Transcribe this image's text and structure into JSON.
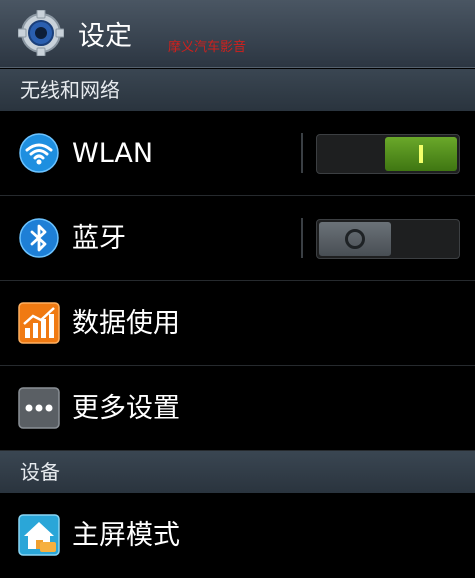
{
  "header": {
    "title": "设定",
    "watermark": "摩义汽车影音"
  },
  "sections": {
    "wireless": "无线和网络",
    "device": "设备"
  },
  "items": {
    "wlan": {
      "label": "WLAN",
      "icon": "wifi-icon",
      "toggle": "on"
    },
    "bluetooth": {
      "label": "蓝牙",
      "icon": "bluetooth-icon",
      "toggle": "off"
    },
    "data_usage": {
      "label": "数据使用",
      "icon": "data-usage-icon"
    },
    "more": {
      "label": "更多设置",
      "icon": "more-icon"
    },
    "home_mode": {
      "label": "主屏模式",
      "icon": "home-mode-icon"
    }
  },
  "colors": {
    "header_bg": "#3b4653",
    "toggle_on": "#5a9a22",
    "wifi_blue": "#1e8fe0"
  }
}
